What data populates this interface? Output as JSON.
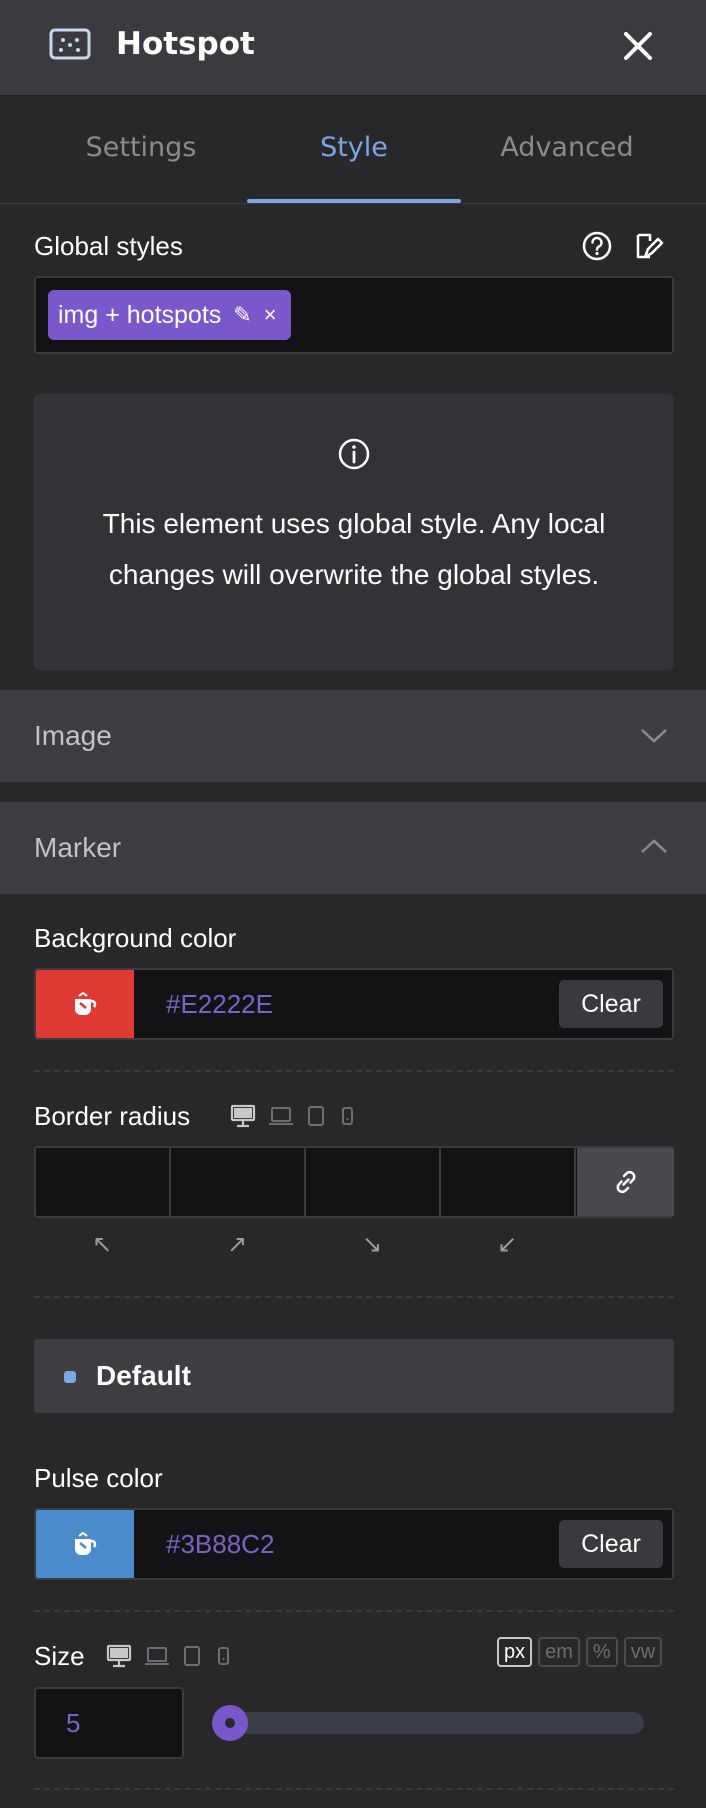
{
  "header": {
    "title": "Hotspot",
    "icon": "hotspot-icon",
    "close_icon": "close-icon"
  },
  "tabs": [
    {
      "label": "Settings",
      "active": false
    },
    {
      "label": "Style",
      "active": true
    },
    {
      "label": "Advanced",
      "active": false
    }
  ],
  "global_styles": {
    "label": "Global styles",
    "chip": {
      "label": "img + hotspots",
      "edit_icon": "✎",
      "remove_icon": "×"
    },
    "notice": "This element uses global style. Any local changes will overwrite the global styles."
  },
  "sections": {
    "image": {
      "title": "Image",
      "expanded": false
    },
    "marker": {
      "title": "Marker",
      "expanded": true
    }
  },
  "marker": {
    "background_color": {
      "label": "Background color",
      "value": "#E2222E",
      "swatch": "#E2222E",
      "clear_label": "Clear"
    },
    "border_radius": {
      "label": "Border radius",
      "corners": [
        "↖",
        "↗",
        "↘",
        "↙"
      ]
    },
    "state": {
      "label": "Default"
    },
    "pulse_color": {
      "label": "Pulse color",
      "value": "#3B88C2",
      "swatch": "#4a8ccb",
      "clear_label": "Clear"
    },
    "size": {
      "label": "Size",
      "value": "5",
      "units": [
        "px",
        "em",
        "%",
        "vw"
      ],
      "active_unit": "px",
      "slider_fraction": 0.0
    }
  },
  "colors": {
    "accent": "#7a58cc",
    "active_tab": "#7ba6e1",
    "panel": "#28282b"
  }
}
